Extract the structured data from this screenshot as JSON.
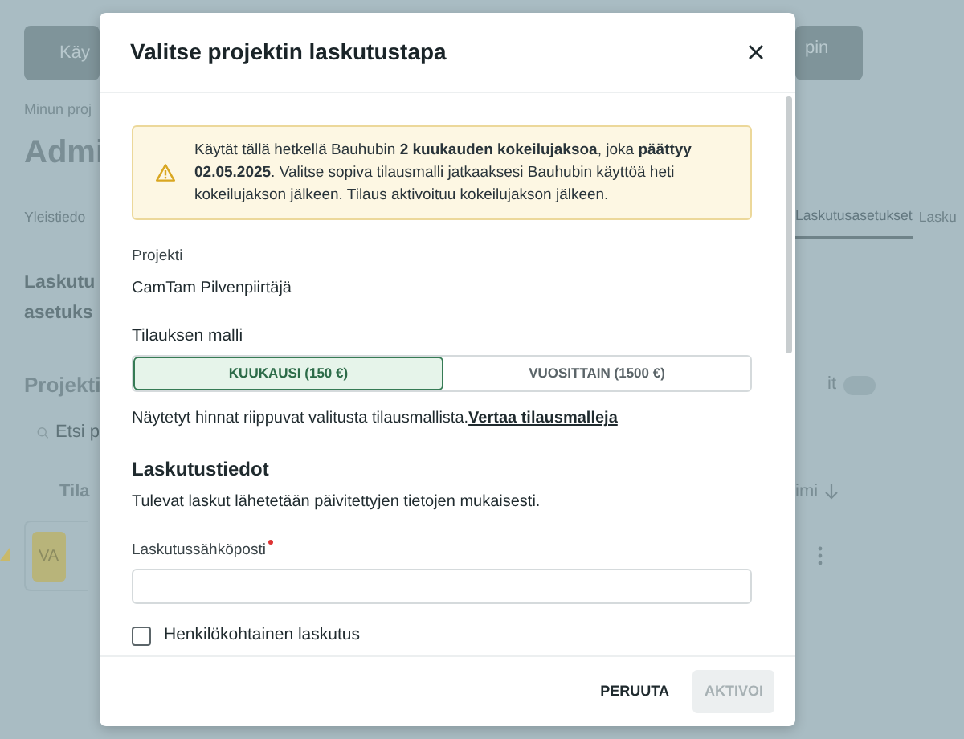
{
  "background": {
    "top_buttons": [
      "Käy",
      "pin"
    ],
    "breadcrumb": "Minun proj",
    "page_title": "Admi",
    "tabs": [
      {
        "label": "Yleistiedo",
        "selected": false
      },
      {
        "label": "Laskutusasetukset",
        "selected": true
      },
      {
        "label": "Lasku",
        "selected": false
      }
    ],
    "section_title": [
      "Laskutu",
      "asetuks"
    ],
    "projects_title": "Projekti",
    "toggle_label": "it",
    "toggle_on": false,
    "search_placeholder": "Etsi p",
    "column_1": "Tila",
    "column_2": "imi",
    "row_badge": "VA"
  },
  "modal": {
    "title": "Valitse projektin laskutustapa",
    "alert": "Käytät tällä hetkellä Bauhubin **2 kuukauden kokeilujaksoa**, joka **päättyy 02.05.2025**. Valitse sopiva tilausmalli jatkaaksesi Bauhubin käyttöä heti kokeilujakson jälkeen. Tilaus aktivoituu kokeilujakson jälkeen.",
    "project_label": "Projekti",
    "project_value": "CamTam Pilvenpiirtäjä",
    "plan_label": "Tilauksen malli",
    "plans": [
      {
        "label": "KUUKAUSI (150 €)",
        "selected": true
      },
      {
        "label": "VUOSITTAIN (1500 €)",
        "selected": false
      }
    ],
    "plan_note": "Näytetyt hinnat riippuvat valitusta tilausmallista.",
    "compare_link": "Vertaa tilausmalleja",
    "billing_title": "Laskutustiedot",
    "billing_note": "Tulevat laskut lähetetään päivitettyjen tietojen mukaisesti.",
    "email_label": "Laskutussähköposti",
    "email_required": true,
    "personal_billing": {
      "label": "Henkilökohtainen laskutus",
      "checked": false
    },
    "buttons": [
      {
        "label": "PERUUTA",
        "disabled": false
      },
      {
        "label": "AKTIVOI",
        "disabled": true
      }
    ]
  }
}
